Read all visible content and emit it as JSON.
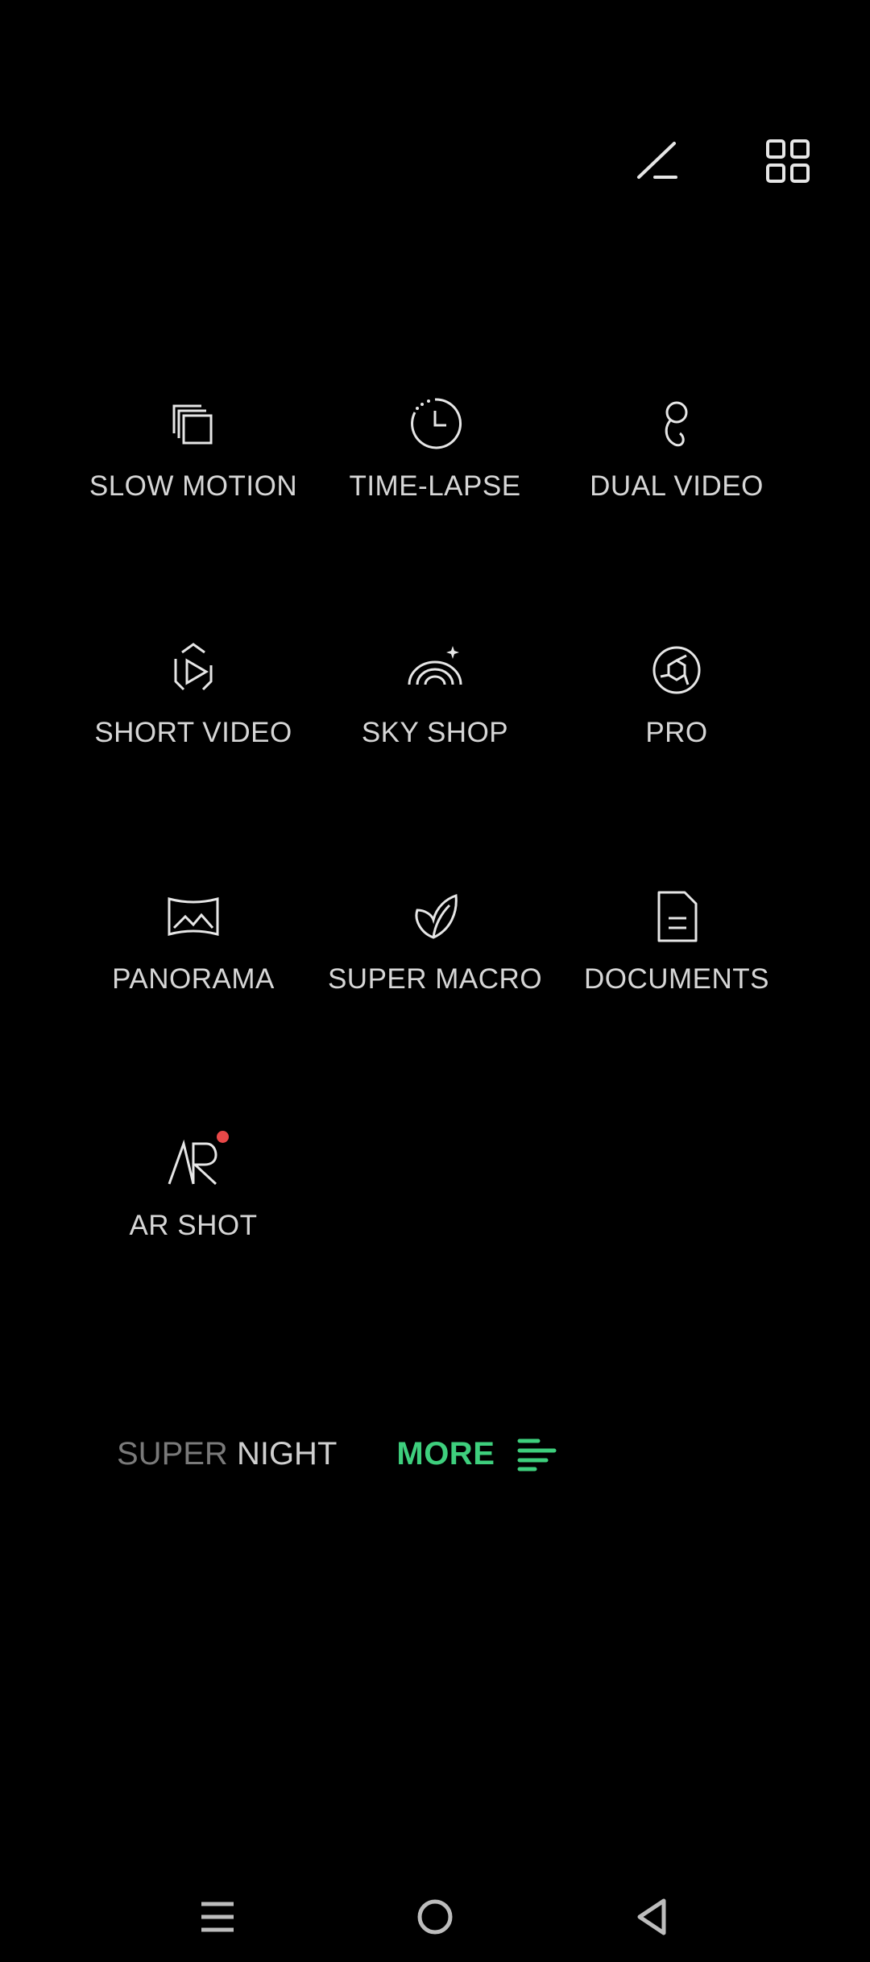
{
  "toolbar": {
    "icons": [
      "edit-icon",
      "grid-icon"
    ]
  },
  "modes": [
    {
      "label": "SLOW MOTION",
      "icon": "slow-motion-icon"
    },
    {
      "label": "TIME-LAPSE",
      "icon": "time-lapse-icon"
    },
    {
      "label": "DUAL VIDEO",
      "icon": "dual-video-icon"
    },
    {
      "label": "SHORT VIDEO",
      "icon": "short-video-icon"
    },
    {
      "label": "SKY SHOP",
      "icon": "sky-shop-icon"
    },
    {
      "label": "PRO",
      "icon": "pro-aperture-icon"
    },
    {
      "label": "PANORAMA",
      "icon": "panorama-icon"
    },
    {
      "label": "SUPER MACRO",
      "icon": "leaf-icon"
    },
    {
      "label": "DOCUMENTS",
      "icon": "document-icon"
    },
    {
      "label": "AR SHOT",
      "icon": "ar-icon",
      "badge": "new-dot"
    }
  ],
  "bottom_bar": {
    "super_night_part1": "SUPER ",
    "super_night_part2": "NIGHT",
    "more_label": "MORE"
  },
  "nav": {
    "icons": [
      "menu-icon",
      "home-icon",
      "back-icon"
    ]
  },
  "colors": {
    "background": "#000000",
    "text": "#d6d6d6",
    "accent": "#3ecf7d",
    "badge": "#e94848",
    "dim_text": "#7a7a7a"
  }
}
